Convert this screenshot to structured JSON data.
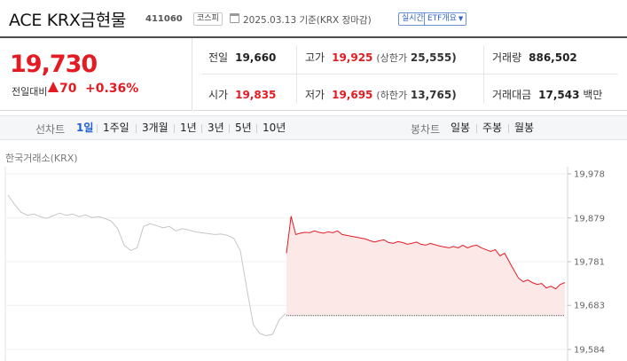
{
  "header": {
    "name": "ACE KRX금현물",
    "code": "411060",
    "market_badge": "코스피",
    "date_text": "2025.03.13 기준(KRX 장마감)",
    "live_badge": "실시간",
    "etf_badge": "ETF개요"
  },
  "price": {
    "current": "19,730",
    "change_label": "전일대비",
    "change_value": "70",
    "change_pct": "+0.36%",
    "up_color": "#e31b23"
  },
  "stats": {
    "prev_close_label": "전일",
    "prev_close": "19,660",
    "high_label": "고가",
    "high": "19,925",
    "upper_limit_label": "(상한가",
    "upper_limit": "25,555)",
    "volume_label": "거래량",
    "volume": "886,502",
    "open_label": "시가",
    "open": "19,835",
    "low_label": "저가",
    "low": "19,695",
    "lower_limit_label": "(하한가",
    "lower_limit": "13,765)",
    "amount_label": "거래대금",
    "amount": "17,543",
    "amount_unit": "백만"
  },
  "periods": {
    "label": "선차트",
    "items": [
      "1일",
      "1주일",
      "3개월",
      "1년",
      "3년",
      "5년",
      "10년"
    ],
    "active": "1일"
  },
  "candle": {
    "label": "봉차트",
    "items": [
      "일봉",
      "주봉",
      "월봉"
    ]
  },
  "exchange": "한국거래소(KRX)",
  "chart_data": {
    "type": "line",
    "title": "",
    "xlabel": "",
    "ylabel": "",
    "yticks": [
      "19,978",
      "19,879",
      "19,781",
      "19,683",
      "19,584"
    ],
    "ylim": [
      19584,
      19978
    ],
    "baseline": 19660,
    "series": [
      {
        "key": "previous",
        "color": "#c6c6c6",
        "values": [
          19930,
          19910,
          19892,
          19885,
          19888,
          19882,
          19878,
          19884,
          19890,
          19885,
          19888,
          19882,
          19886,
          19880,
          19882,
          19878,
          19872,
          19855,
          19818,
          19806,
          19812,
          19860,
          19866,
          19862,
          19857,
          19860,
          19850,
          19855,
          19852,
          19848,
          19846,
          19844,
          19842,
          19843,
          19840,
          19833,
          19805,
          19720,
          19640,
          19620,
          19615,
          19618,
          19650,
          19665
        ]
      },
      {
        "key": "today",
        "color": "#e31b23",
        "fill": "#fde8e8",
        "values": [
          19800,
          19883,
          19842,
          19845,
          19847,
          19846,
          19850,
          19847,
          19845,
          19848,
          19846,
          19850,
          19842,
          19840,
          19838,
          19836,
          19834,
          19832,
          19828,
          19825,
          19828,
          19830,
          19824,
          19822,
          19826,
          19824,
          19820,
          19822,
          19825,
          19820,
          19818,
          19822,
          19819,
          19816,
          19814,
          19812,
          19815,
          19812,
          19818,
          19812,
          19816,
          19818,
          19812,
          19808,
          19804,
          19808,
          19794,
          19800,
          19781,
          19762,
          19744,
          19736,
          19740,
          19734,
          19730,
          19732,
          19722,
          19726,
          19720,
          19730,
          19734
        ]
      }
    ]
  }
}
